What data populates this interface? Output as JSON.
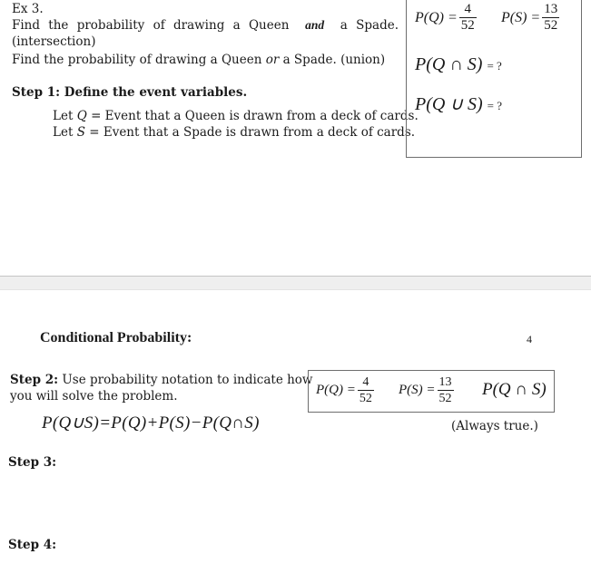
{
  "page1": {
    "example_label": "Ex 3.",
    "q1_part1": "Find the probability of drawing a Queen",
    "q1_and": "and",
    "q1_part2": "a Spade.",
    "q1_note": "(intersection)",
    "q2_part1": "Find the probability of drawing a Queen",
    "q2_or": "or",
    "q2_part2": "a Spade.  (union)",
    "step1_heading": "Step 1: Define the event variables.",
    "let_q_prefix": "Let",
    "let_q_var": "Q",
    "let_q_text": "= Event that a Queen is drawn from a deck of cards.",
    "let_s_prefix": "Let",
    "let_s_var": "S",
    "let_s_text": "= Event that a Spade is drawn from a deck of cards.",
    "box": {
      "pq_label": "P(Q) =",
      "pq_num": "4",
      "pq_den": "52",
      "ps_label": "P(S) =",
      "ps_num": "13",
      "ps_den": "52",
      "intersection_expr": "P(Q ∩ S)",
      "intersection_value": "= ?",
      "union_expr": "P(Q ∪ S)",
      "union_value": "= ?"
    }
  },
  "page2": {
    "heading": "Conditional Probability:",
    "page_number": "4",
    "step2_bold": "Step 2:",
    "step2_line1": "Use probability notation to indicate how",
    "step2_line2": "you will solve the problem.",
    "formula": "P(Q∪S)=P(Q)+P(S)−P(Q∩S)",
    "box": {
      "pq_label": "P(Q) =",
      "pq_num": "4",
      "pq_den": "52",
      "ps_label": "P(S) =",
      "ps_num": "13",
      "ps_den": "52",
      "intersection_expr": "P(Q ∩ S)"
    },
    "always_true": "(Always true.)",
    "step3": "Step 3:",
    "step4": "Step 4:"
  }
}
